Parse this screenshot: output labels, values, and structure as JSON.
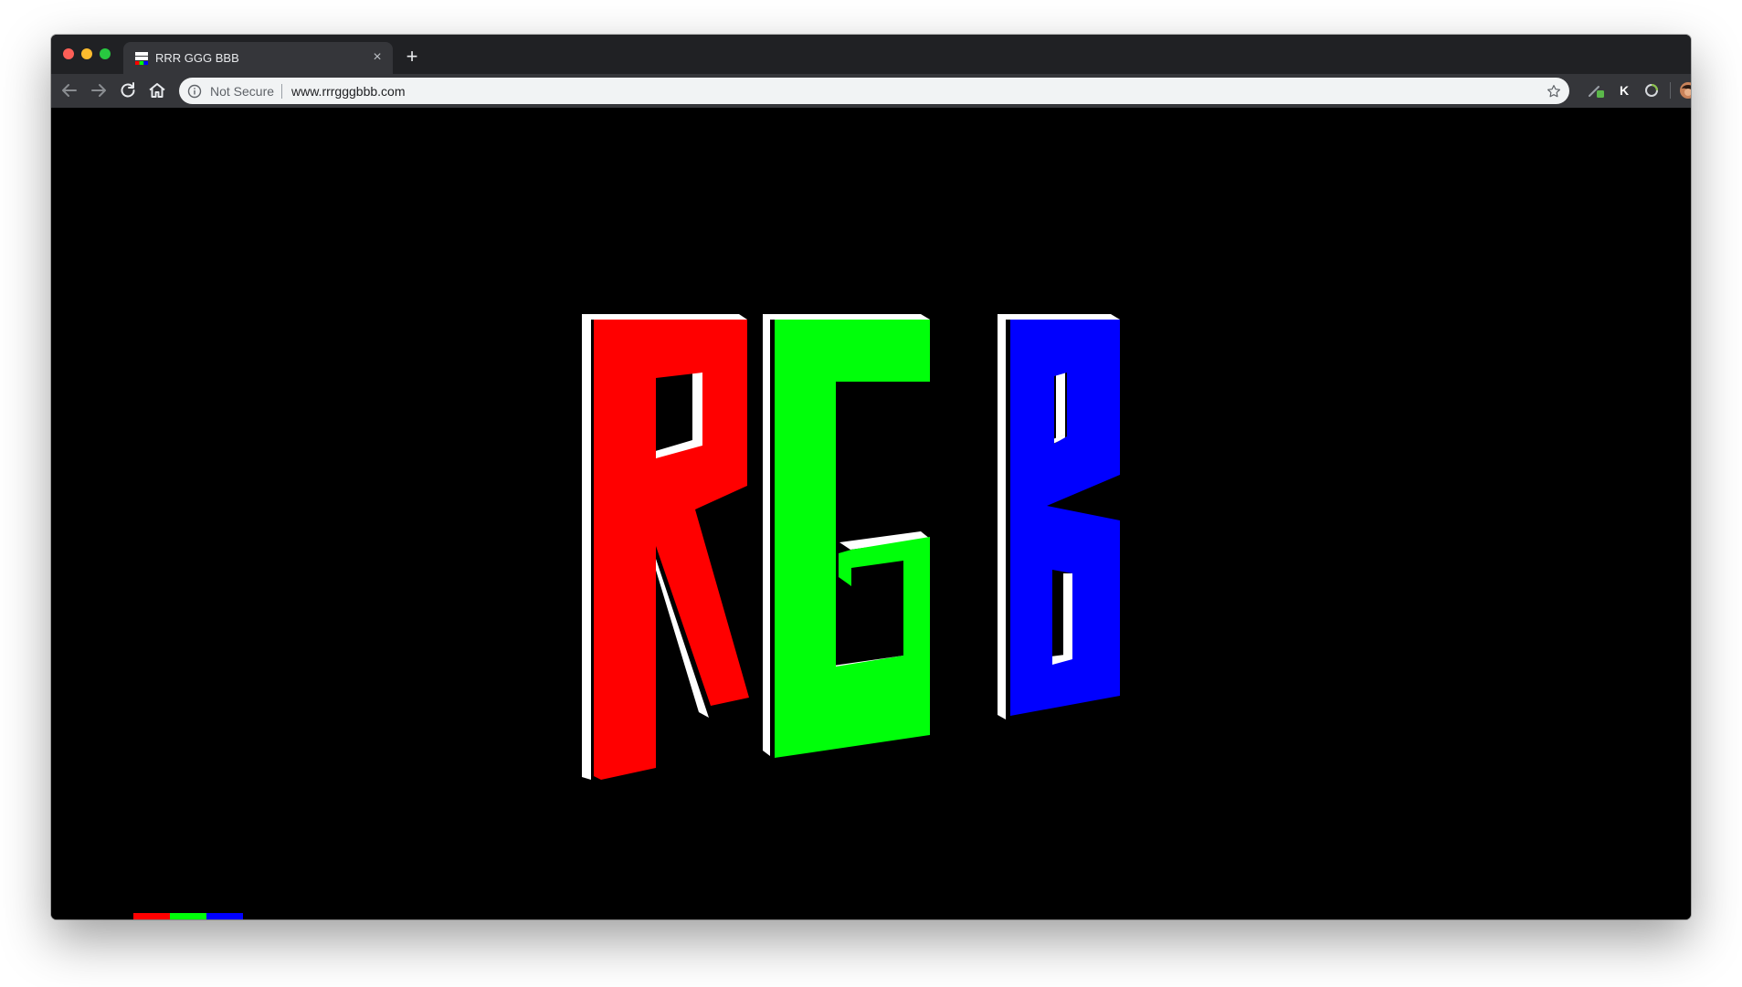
{
  "window": {
    "traffic_lights": [
      "close",
      "minimize",
      "maximize"
    ]
  },
  "tab": {
    "title": "RRR GGG BBB",
    "close_symbol": "×",
    "favicon": "rgb-stripes-favicon-icon"
  },
  "new_tab_symbol": "+",
  "toolbar": {
    "back": "back-arrow-icon",
    "forward": "forward-arrow-icon",
    "reload": "reload-icon",
    "home": "home-icon"
  },
  "omnibox": {
    "security_label": "Not Secure",
    "url": "www.rrrgggbbb.com",
    "bookmark": "star-icon"
  },
  "extensions": {
    "k_label": "K",
    "menu": "kebab-menu-icon"
  },
  "page": {
    "logo_letters": [
      "R",
      "G",
      "B"
    ],
    "colors": {
      "red": "#ff0000",
      "green": "#00ff0a",
      "blue": "#0000ff",
      "extrusion": "#ffffff",
      "background": "#000000"
    },
    "bottom_bar_colors": [
      "#ff0000",
      "#00ff0a",
      "#0000ff"
    ]
  }
}
